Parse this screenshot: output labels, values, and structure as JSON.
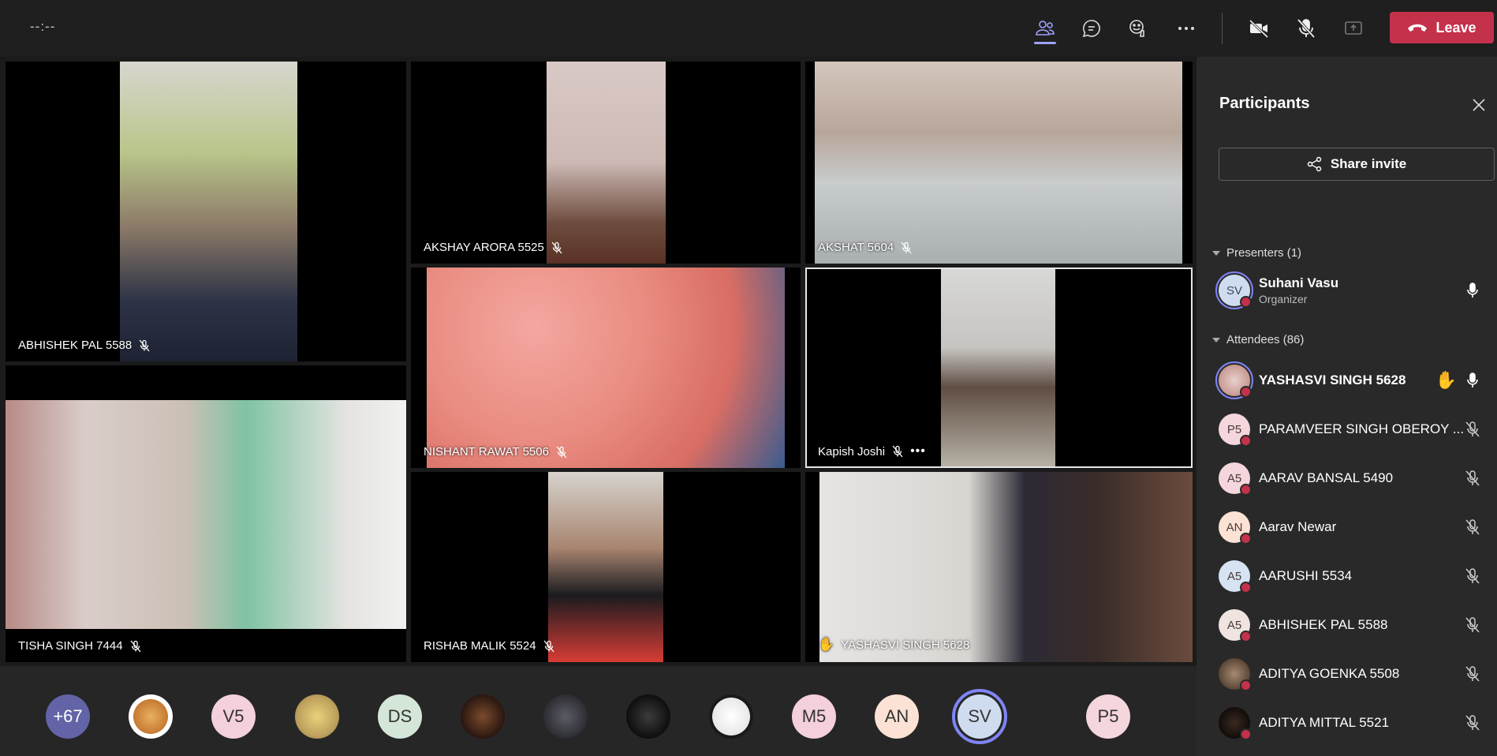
{
  "topbar": {
    "timer": "--:--",
    "leave_label": "Leave"
  },
  "tiles": [
    {
      "name": "ABHISHEK PAL 5588",
      "muted": true
    },
    {
      "name": "AKSHAY ARORA 5525",
      "muted": true
    },
    {
      "name": "AKSHAT 5604",
      "muted": true
    },
    {
      "name": "NISHANT RAWAT 5506",
      "muted": true
    },
    {
      "name": "Kapish Joshi",
      "muted": true
    },
    {
      "name": "TISHA SINGH 7444",
      "muted": true
    },
    {
      "name": "RISHAB MALIK 5524",
      "muted": true
    },
    {
      "name": "YASHASVI SINGH 5628",
      "muted": false,
      "hand_raised": true
    }
  ],
  "strip": [
    {
      "label": "+67"
    },
    {
      "label": ""
    },
    {
      "label": "V5"
    },
    {
      "label": ""
    },
    {
      "label": "DS"
    },
    {
      "label": ""
    },
    {
      "label": ""
    },
    {
      "label": ""
    },
    {
      "label": ""
    },
    {
      "label": "M5"
    },
    {
      "label": "AN"
    },
    {
      "label": "SV"
    },
    {
      "label": "P5"
    }
  ],
  "panel": {
    "title": "Participants",
    "share_invite": "Share invite",
    "presenters_label": "Presenters (1)",
    "attendees_label": "Attendees (86)",
    "presenter": {
      "initials": "SV",
      "name": "Suhani Vasu",
      "role": "Organizer"
    },
    "attendees": [
      {
        "initials": "",
        "name": "YASHASVI SINGH 5628",
        "bold": true
      },
      {
        "initials": "P5",
        "name": "PARAMVEER SINGH OBEROY ..."
      },
      {
        "initials": "A5",
        "name": "AARAV BANSAL 5490"
      },
      {
        "initials": "AN",
        "name": "Aarav Newar"
      },
      {
        "initials": "A5",
        "name": "AARUSHI 5534"
      },
      {
        "initials": "A5",
        "name": "ABHISHEK PAL 5588"
      },
      {
        "initials": "",
        "name": "ADITYA GOENKA 5508"
      },
      {
        "initials": "",
        "name": "ADITYA MITTAL 5521"
      }
    ]
  }
}
